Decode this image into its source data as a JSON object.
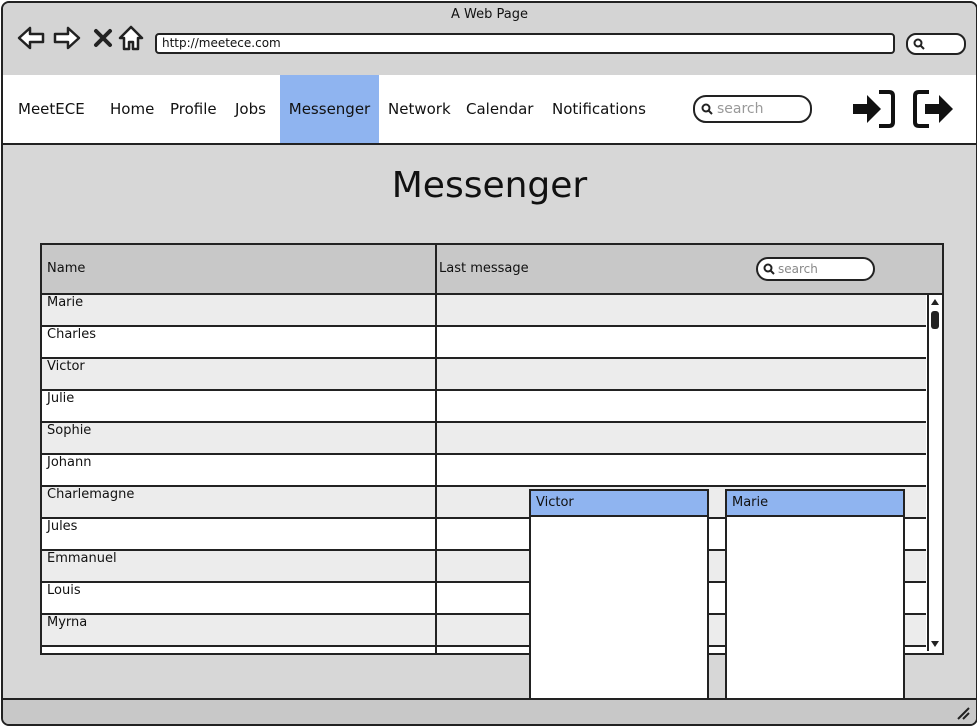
{
  "window": {
    "title": "A Web Page"
  },
  "browser": {
    "url": "http://meetece.com"
  },
  "nav": {
    "brand": "MeetECE",
    "items": [
      "Home",
      "Profile",
      "Jobs",
      "Messenger",
      "Network",
      "Calendar",
      "Notifications"
    ],
    "active": "Messenger",
    "search_placeholder": "search"
  },
  "page": {
    "title": "Messenger"
  },
  "table": {
    "headers": {
      "name": "Name",
      "last_message": "Last message"
    },
    "search_placeholder": "search",
    "rows": [
      "Marie",
      "Charles",
      "Victor",
      "Julie",
      "Sophie",
      "Johann",
      "Charlemagne",
      "Jules",
      "Emmanuel",
      "Louis",
      "Myrna"
    ]
  },
  "chats": [
    {
      "name": "Victor"
    },
    {
      "name": "Marie"
    }
  ],
  "colors": {
    "accent": "#8fb4f0",
    "background": "#d7d7d7",
    "border": "#222222"
  }
}
